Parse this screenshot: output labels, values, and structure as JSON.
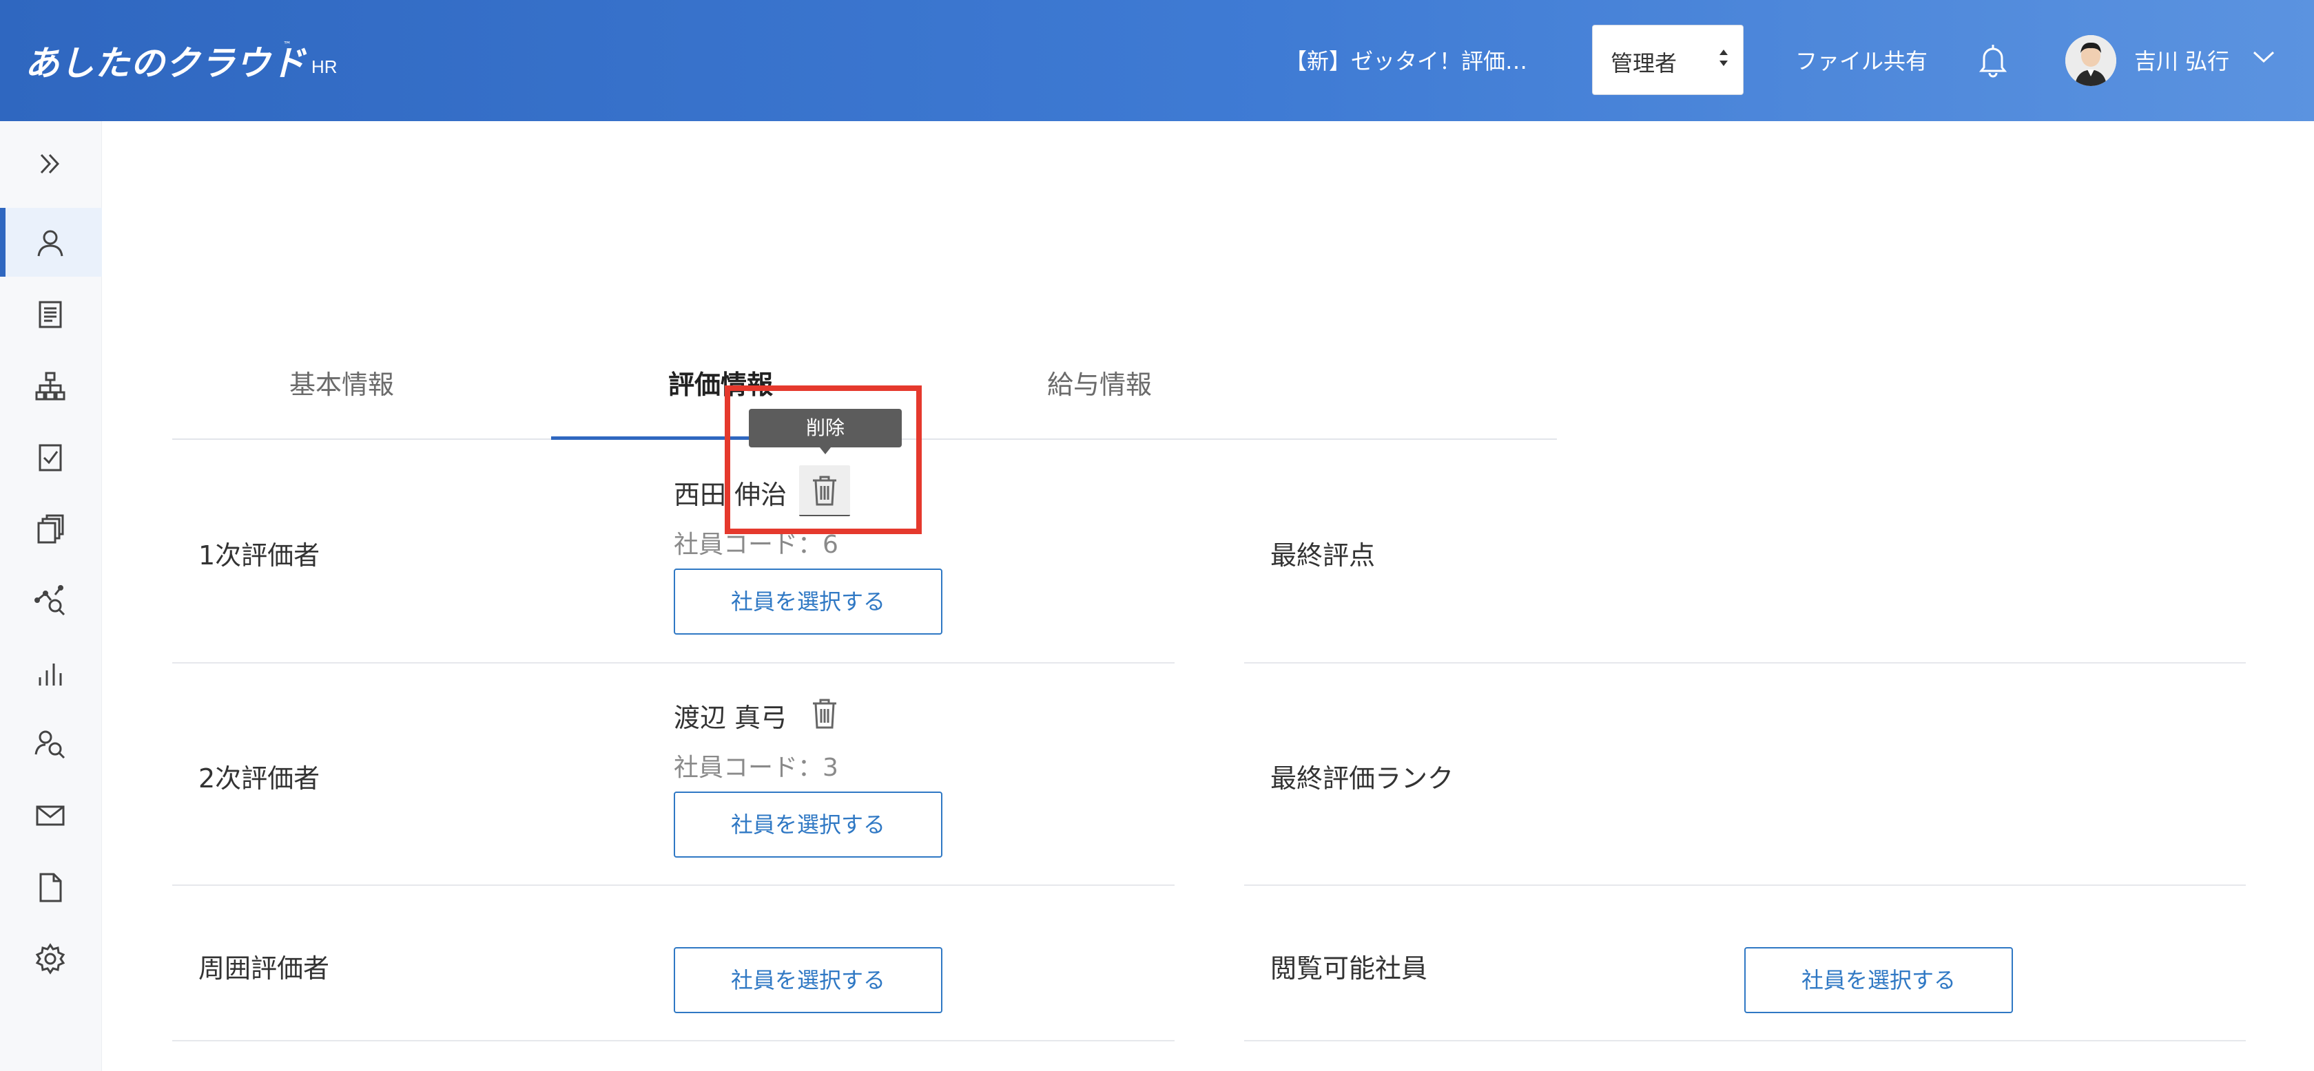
{
  "header": {
    "logo": "あしたのクラウド",
    "logo_tm": "™",
    "logo_sub": "HR",
    "project": "【新】ゼッタイ！評価…",
    "role": "管理者",
    "file_share": "ファイル共有",
    "user_name": "吉川 弘行",
    "bg_color": "#2f67c0"
  },
  "sidebar": {
    "items": [
      {
        "icon": "expand-icon"
      },
      {
        "icon": "person-icon",
        "active": true
      },
      {
        "icon": "document-icon"
      },
      {
        "icon": "org-chart-icon"
      },
      {
        "icon": "checklist-icon"
      },
      {
        "icon": "copy-icon"
      },
      {
        "icon": "analysis-search-icon"
      },
      {
        "icon": "bar-chart-icon"
      },
      {
        "icon": "person-search-icon"
      },
      {
        "icon": "mail-icon"
      },
      {
        "icon": "file-icon"
      },
      {
        "icon": "settings-icon"
      }
    ]
  },
  "tabs": [
    {
      "label": "基本情報",
      "active": false
    },
    {
      "label": "評価情報",
      "active": true
    },
    {
      "label": "給与情報",
      "active": false
    }
  ],
  "evaluators": {
    "first": {
      "label": "1次評価者",
      "name": "西田 伸治",
      "code": "社員コード：6",
      "button": "社員を選択する"
    },
    "second": {
      "label": "2次評価者",
      "name": "渡辺 真弓",
      "code": "社員コード：3",
      "button": "社員を選択する"
    },
    "peer": {
      "label": "周囲評価者",
      "button": "社員を選択する"
    }
  },
  "right_column": {
    "final_score_label": "最終評点",
    "final_rank_label": "最終評価ランク",
    "viewer_label": "閲覧可能社員",
    "viewer_button": "社員を選択する"
  },
  "tooltip": {
    "text": "削除"
  },
  "accent_color": "#2f78c4",
  "highlight_color": "#e5392d"
}
